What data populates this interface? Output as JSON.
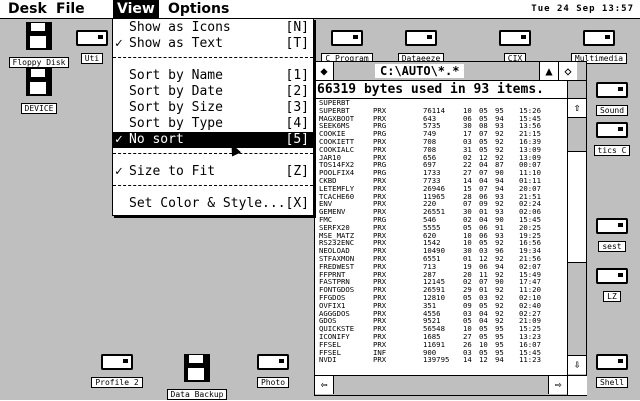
{
  "menubar": {
    "items": [
      "Desk",
      "File",
      "View",
      "Options"
    ],
    "clock": "Tue 24 Sep 13:57"
  },
  "desktop": {
    "icons": [
      {
        "label": "Floppy Disk",
        "kind": "floppy"
      },
      {
        "label": "Uti",
        "kind": "drive"
      },
      {
        "label": "DEVICE",
        "kind": "floppy"
      },
      {
        "label": "C Program",
        "kind": "drive"
      },
      {
        "label": "Dataeeze",
        "kind": "drive"
      },
      {
        "label": "CIX",
        "kind": "drive"
      },
      {
        "label": "Multimedia",
        "kind": "drive"
      },
      {
        "label": "Sound",
        "kind": "drive"
      },
      {
        "label": "tics C",
        "kind": "drive"
      },
      {
        "label": "sest",
        "kind": "drive"
      },
      {
        "label": "LZ",
        "kind": "drive"
      },
      {
        "label": "Profile 2",
        "kind": "drive"
      },
      {
        "label": "Data Backup",
        "kind": "floppy"
      },
      {
        "label": "Photo",
        "kind": "drive"
      },
      {
        "label": "Shell",
        "kind": "drive"
      }
    ]
  },
  "view_menu": {
    "items": [
      {
        "check": "",
        "label": "Show as Icons",
        "key": "[N]"
      },
      {
        "check": "✓",
        "label": "Show as Text",
        "key": "[T]"
      },
      {
        "check": "",
        "label": "Sort by Name",
        "key": "[1]"
      },
      {
        "check": "",
        "label": "Sort by Date",
        "key": "[2]"
      },
      {
        "check": "",
        "label": "Sort by Size",
        "key": "[3]"
      },
      {
        "check": "",
        "label": "Sort by Type",
        "key": "[4]"
      },
      {
        "check": "✓",
        "label": "No sort",
        "key": "[5]"
      },
      {
        "check": "✓",
        "label": "Size to Fit",
        "key": "[Z]"
      },
      {
        "check": "",
        "label": "Set Color & Style...",
        "key": "[X]"
      }
    ]
  },
  "window": {
    "title": "C:\\AUTO\\*.*",
    "info": "66319 bytes used in 93 items.",
    "close_glyph": "◆",
    "up_glyph": "▲",
    "full_glyph": "◇",
    "scroll_up": "⇧",
    "scroll_down": "⇩",
    "scroll_left": "⇦",
    "scroll_right": "⇨",
    "files": [
      [
        "SUPERBT",
        "",
        "",
        "",
        "",
        "",
        ""
      ],
      [
        "SUPERBT",
        "PRX",
        "76114",
        "10",
        "05",
        "95",
        "15:26"
      ],
      [
        "MAGXBOOT",
        "PRX",
        "643",
        "06",
        "05",
        "94",
        "15:45"
      ],
      [
        "SEEK6MS",
        "PRG",
        "5735",
        "30",
        "08",
        "93",
        "13:56"
      ],
      [
        "COOKIE",
        "PRG",
        "749",
        "17",
        "07",
        "92",
        "21:15"
      ],
      [
        "COOKIETT",
        "PRX",
        "708",
        "03",
        "05",
        "92",
        "16:39"
      ],
      [
        "COOKIALC",
        "PRX",
        "708",
        "31",
        "05",
        "92",
        "13:09"
      ],
      [
        "JAR10",
        "PRX",
        "656",
        "02",
        "12",
        "92",
        "13:09"
      ],
      [
        "TOS14FX2",
        "PRG",
        "697",
        "22",
        "04",
        "87",
        "00:07"
      ],
      [
        "POOLFIX4",
        "PRG",
        "1733",
        "27",
        "07",
        "90",
        "11:10"
      ],
      [
        "CKBD",
        "PRX",
        "7733",
        "14",
        "04",
        "94",
        "01:11"
      ],
      [
        "LETEMFLY",
        "PRX",
        "26946",
        "15",
        "07",
        "94",
        "20:07"
      ],
      [
        "TCACHE60",
        "PRX",
        "11965",
        "28",
        "06",
        "93",
        "21:51"
      ],
      [
        "ENV",
        "PRX",
        "220",
        "07",
        "09",
        "92",
        "02:24"
      ],
      [
        "GEMENV",
        "PRX",
        "26551",
        "30",
        "01",
        "93",
        "02:06"
      ],
      [
        "FMC",
        "PRG",
        "546",
        "02",
        "04",
        "90",
        "15:45"
      ],
      [
        "SERFX20",
        "PRX",
        "5555",
        "05",
        "06",
        "91",
        "20:25"
      ],
      [
        "MSE_MATZ",
        "PRX",
        "620",
        "10",
        "06",
        "93",
        "19:25"
      ],
      [
        "RS232ENC",
        "PRX",
        "1542",
        "10",
        "05",
        "92",
        "16:56"
      ],
      [
        "NEOLOAD",
        "PRX",
        "10490",
        "30",
        "03",
        "96",
        "19:34"
      ],
      [
        "STFAXMON",
        "PRX",
        "6551",
        "01",
        "12",
        "92",
        "21:56"
      ],
      [
        "FREDWEST",
        "PRX",
        "713",
        "19",
        "06",
        "94",
        "02:07"
      ],
      [
        "FFPRNT",
        "PRX",
        "287",
        "20",
        "11",
        "92",
        "15:49"
      ],
      [
        "FASTPRN",
        "PRX",
        "12145",
        "02",
        "07",
        "90",
        "17:47"
      ],
      [
        "FONTGDOS",
        "PRX",
        "26591",
        "29",
        "01",
        "92",
        "11:20"
      ],
      [
        "FFGDOS",
        "PRX",
        "12810",
        "05",
        "03",
        "92",
        "02:10"
      ],
      [
        "OVFIX1",
        "PRX",
        "351",
        "09",
        "05",
        "92",
        "02:40"
      ],
      [
        "AGGGDOS",
        "PRX",
        "4556",
        "03",
        "04",
        "92",
        "02:27"
      ],
      [
        "GDOS",
        "PRX",
        "9521",
        "05",
        "04",
        "92",
        "21:09"
      ],
      [
        "QUICKSTE",
        "PRX",
        "56548",
        "10",
        "05",
        "95",
        "15:25"
      ],
      [
        "ICONIFY",
        "PRX",
        "1685",
        "27",
        "05",
        "95",
        "13:23"
      ],
      [
        "FFSEL",
        "PRX",
        "11691",
        "26",
        "10",
        "95",
        "16:07"
      ],
      [
        "FFSEL",
        "INF",
        "900",
        "03",
        "05",
        "95",
        "15:45"
      ],
      [
        "NVDI",
        "PRX",
        "139795",
        "14",
        "12",
        "94",
        "11:23"
      ]
    ]
  }
}
